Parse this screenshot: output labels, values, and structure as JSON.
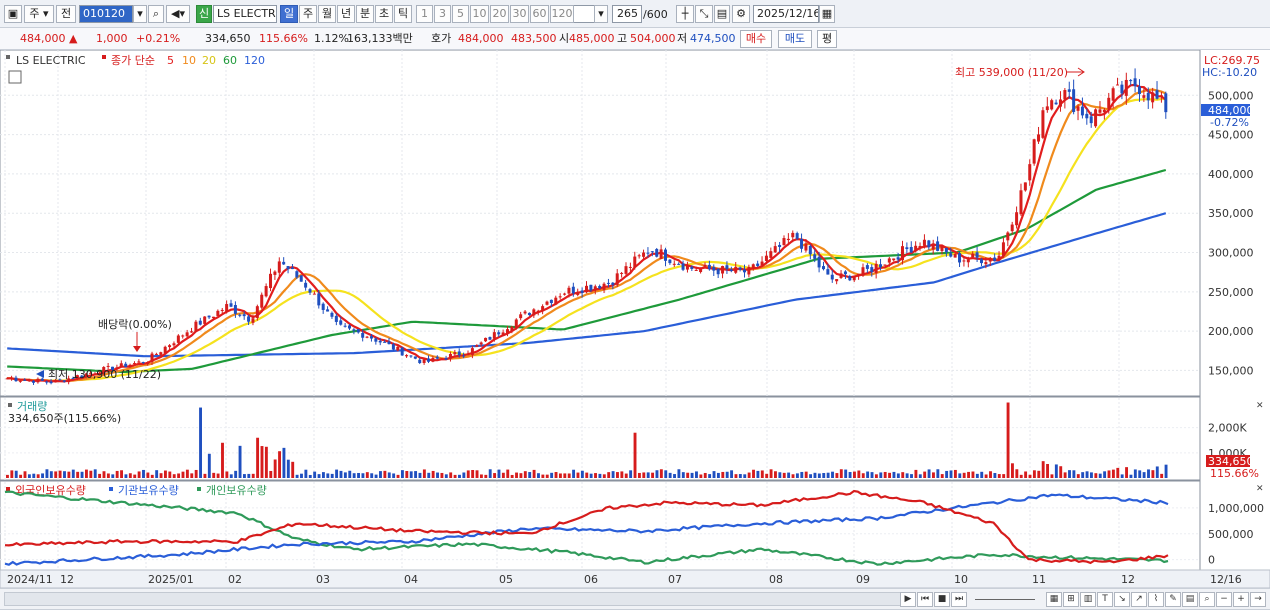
{
  "toolbar": {
    "mode_day": "주",
    "mode_prev": "전",
    "code": "010120",
    "stock_name": "LS ELECTRI",
    "new_badge": "신",
    "periods": [
      "일",
      "주",
      "월",
      "년",
      "분",
      "초",
      "틱"
    ],
    "period_active_index": 0,
    "intervals": [
      "1",
      "3",
      "5",
      "10",
      "20",
      "30",
      "60",
      "120"
    ],
    "count": "265",
    "count_max": "/600",
    "date": "2025/12/16"
  },
  "quote": {
    "price": "484,000 ▲",
    "change": "1,000",
    "change_pct": "+0.21%",
    "volume": "334,650",
    "volume_ratio": "115.66%",
    "turnover": "1.12%",
    "value": "163,133백만",
    "bid_label": "호가",
    "bid": "484,000",
    "ask": "483,500",
    "open_label": "시",
    "open": "485,000",
    "high_label": "고",
    "high": "504,000",
    "low_label": "저",
    "low": "474,500",
    "buy_button": "매수",
    "sell_button": "매도",
    "eval_button": "평"
  },
  "price_panel": {
    "stock_label": "LS ELECTRIC",
    "ma_label": "종가 단순",
    "ma_periods": [
      "5",
      "10",
      "20",
      "60",
      "120"
    ],
    "lc": "LC:269.75",
    "hc": "HC:-10.20",
    "max_annotation": "최고 539,000 (11/20)",
    "min_annotation": "최저 130,900 (11/22)",
    "dividend_annotation": "배당락(0.00%)",
    "current_price_tag": "484,000",
    "current_change_tag": "-0.72%",
    "y_ticks": [
      "500,000",
      "450,000",
      "400,000",
      "350,000",
      "300,000",
      "250,000",
      "200,000",
      "150,000"
    ]
  },
  "volume_panel": {
    "title": "거래량",
    "value_label": "334,650주(115.66%)",
    "y_ticks": [
      "2,000K",
      "1,000K"
    ],
    "current_tag": "334,650",
    "current_pct_tag": "115.66%"
  },
  "holding_panel": {
    "legend": [
      "외국인보유수량",
      "기관보유수량",
      "개인보유수량"
    ],
    "y_ticks": [
      "1,000,000",
      "500,000",
      "0"
    ]
  },
  "x_axis": {
    "labels": [
      "2024/11",
      "12",
      "2025/01",
      "02",
      "03",
      "04",
      "05",
      "06",
      "07",
      "08",
      "09",
      "10",
      "11",
      "12"
    ],
    "right_label": "12/16"
  },
  "colors": {
    "up": "#d61c1c",
    "down": "#1f4fbf",
    "ma5": "#e21d1d",
    "ma10": "#f08a1c",
    "ma20": "#f5e21e",
    "ma60": "#1e9a3a",
    "ma120": "#2a5ed8",
    "foreign": "#d61c1c",
    "institution": "#2a5ed8",
    "individual": "#2f9a5a"
  },
  "chart_data": {
    "type": "candlestick",
    "x_range": [
      "2024/11",
      "2025/12/16"
    ],
    "price_ylim": [
      120000,
      550000
    ],
    "max": {
      "value": 539000,
      "date": "11/20"
    },
    "min": {
      "value": 130900,
      "date": "11/22"
    },
    "last_close": 484000,
    "ma_anchor_points": {
      "ma120": [
        [
          0,
          178000
        ],
        [
          0.12,
          168000
        ],
        [
          0.3,
          172000
        ],
        [
          0.45,
          185000
        ],
        [
          0.55,
          200000
        ],
        [
          0.68,
          240000
        ],
        [
          0.8,
          262000
        ],
        [
          0.85,
          285000
        ],
        [
          0.93,
          320000
        ],
        [
          1.0,
          350000
        ]
      ],
      "ma60": [
        [
          0,
          155000
        ],
        [
          0.1,
          148000
        ],
        [
          0.16,
          152000
        ],
        [
          0.28,
          195000
        ],
        [
          0.35,
          212000
        ],
        [
          0.48,
          202000
        ],
        [
          0.58,
          240000
        ],
        [
          0.7,
          292000
        ],
        [
          0.82,
          300000
        ],
        [
          0.88,
          330000
        ],
        [
          0.94,
          380000
        ],
        [
          1.0,
          405000
        ]
      ]
    },
    "price_path": [
      [
        0,
        140000
      ],
      [
        0.04,
        135000
      ],
      [
        0.08,
        150000
      ],
      [
        0.12,
        162000
      ],
      [
        0.16,
        205000
      ],
      [
        0.19,
        232000
      ],
      [
        0.21,
        215000
      ],
      [
        0.235,
        290000
      ],
      [
        0.26,
        255000
      ],
      [
        0.285,
        205000
      ],
      [
        0.31,
        195000
      ],
      [
        0.36,
        160000
      ],
      [
        0.4,
        175000
      ],
      [
        0.44,
        215000
      ],
      [
        0.48,
        250000
      ],
      [
        0.52,
        262000
      ],
      [
        0.555,
        305000
      ],
      [
        0.59,
        280000
      ],
      [
        0.64,
        275000
      ],
      [
        0.68,
        322000
      ],
      [
        0.71,
        265000
      ],
      [
        0.74,
        275000
      ],
      [
        0.79,
        315000
      ],
      [
        0.82,
        292000
      ],
      [
        0.855,
        293000
      ],
      [
        0.88,
        395000
      ],
      [
        0.895,
        490000
      ],
      [
        0.91,
        505000
      ],
      [
        0.935,
        470000
      ],
      [
        0.955,
        500000
      ],
      [
        0.975,
        515000
      ],
      [
        1.0,
        484000
      ]
    ],
    "volume_spikes": [
      [
        0.165,
        2800000
      ],
      [
        0.185,
        1400000
      ],
      [
        0.215,
        1600000
      ],
      [
        0.235,
        1500000
      ],
      [
        0.54,
        1800000
      ],
      [
        0.865,
        3000000
      ]
    ],
    "holdings": {
      "foreign": [
        [
          0,
          280000
        ],
        [
          0.1,
          350000
        ],
        [
          0.2,
          350000
        ],
        [
          0.25,
          700000
        ],
        [
          0.35,
          550000
        ],
        [
          0.45,
          500000
        ],
        [
          0.52,
          1000000
        ],
        [
          0.57,
          1100000
        ],
        [
          0.65,
          1050000
        ],
        [
          0.73,
          1300000
        ],
        [
          0.79,
          1100000
        ],
        [
          0.85,
          700000
        ],
        [
          0.88,
          0
        ],
        [
          0.95,
          -50000
        ],
        [
          1.0,
          80000
        ]
      ],
      "institution": [
        [
          0,
          -80000
        ],
        [
          0.15,
          100000
        ],
        [
          0.25,
          300000
        ],
        [
          0.35,
          350000
        ],
        [
          0.45,
          600000
        ],
        [
          0.55,
          550000
        ],
        [
          0.65,
          700000
        ],
        [
          0.75,
          800000
        ],
        [
          0.85,
          1100000
        ],
        [
          0.9,
          1250000
        ],
        [
          1.0,
          1100000
        ]
      ],
      "individual": [
        [
          0,
          1300000
        ],
        [
          0.1,
          1100000
        ],
        [
          0.2,
          900000
        ],
        [
          0.25,
          400000
        ],
        [
          0.3,
          200000
        ],
        [
          0.4,
          300000
        ],
        [
          0.48,
          150000
        ],
        [
          0.55,
          -50000
        ],
        [
          0.65,
          200000
        ],
        [
          0.75,
          -80000
        ],
        [
          0.85,
          100000
        ],
        [
          0.9,
          50000
        ],
        [
          1.0,
          -20000
        ]
      ]
    }
  }
}
